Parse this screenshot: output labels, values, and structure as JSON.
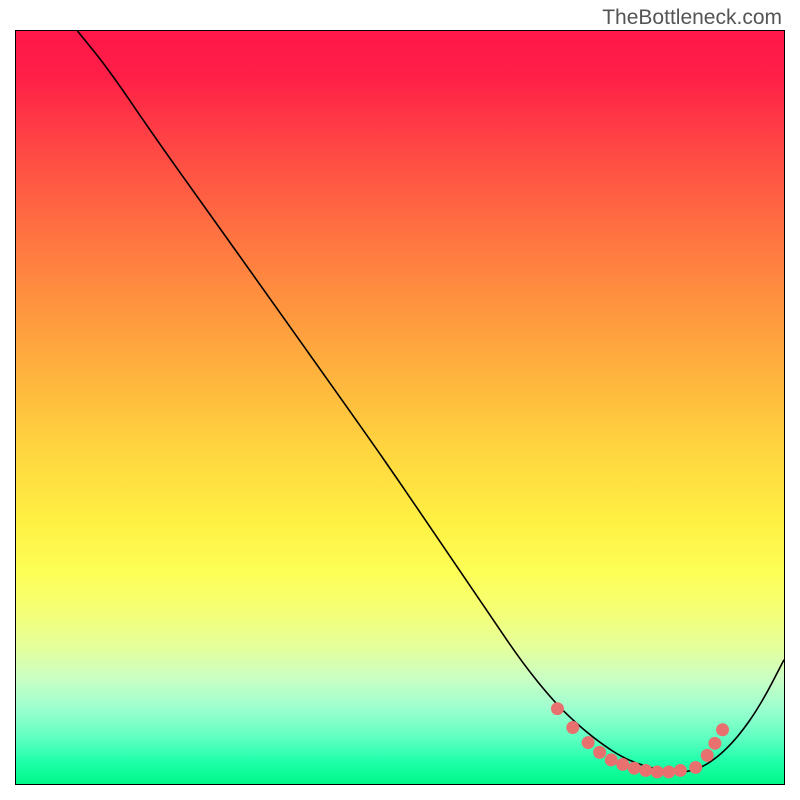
{
  "watermark": "TheBottleneck.com",
  "colors": {
    "gradient_top": "#ff1749",
    "gradient_mid": "#fff043",
    "gradient_bottom": "#00f889",
    "dot_color": "#e8706f",
    "curve_color": "#000000"
  },
  "chart_data": {
    "type": "line",
    "title": "",
    "xlabel": "",
    "ylabel": "",
    "xlim": [
      0,
      100
    ],
    "ylim": [
      0,
      100
    ],
    "series": [
      {
        "name": "curve",
        "x": [
          8,
          12,
          18,
          25,
          32,
          40,
          48,
          56,
          62,
          66,
          70,
          73,
          76,
          79,
          82,
          85,
          88,
          91,
          94,
          97,
          100
        ],
        "y": [
          100,
          95,
          86,
          76,
          66,
          54.5,
          43,
          31,
          22,
          16,
          11,
          8,
          5.5,
          3.5,
          2.3,
          1.6,
          1.6,
          3.2,
          6.2,
          10.6,
          16.5
        ]
      },
      {
        "name": "flat-region-dots",
        "x": [
          70.5,
          72.5,
          74.5,
          76.0,
          77.5,
          79.0,
          80.5,
          82.0,
          83.5,
          85.0,
          86.5,
          88.5,
          90.0,
          91.0,
          92.0
        ],
        "y": [
          10.0,
          7.5,
          5.5,
          4.2,
          3.2,
          2.6,
          2.1,
          1.8,
          1.6,
          1.6,
          1.8,
          2.2,
          3.8,
          5.4,
          7.2
        ]
      }
    ]
  }
}
